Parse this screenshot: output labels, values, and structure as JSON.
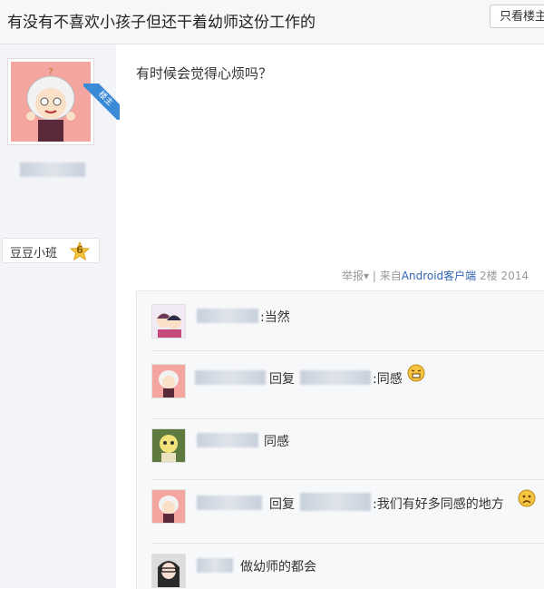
{
  "thread": {
    "title": "有没有不喜欢小孩子但还干着幼师这份工作的",
    "only_op_label": "只看楼主"
  },
  "author": {
    "op_badge": "楼主",
    "badge_label": "豆豆小班",
    "level": "6"
  },
  "post": {
    "text": "有时候会觉得心烦吗？",
    "report_label": "举报",
    "divider": "|",
    "source_prefix": "来自",
    "source_client": "Android客户端",
    "floor": "2楼",
    "time_partial": "2014"
  },
  "replies": [
    {
      "content": ":当然"
    },
    {
      "reply_word": "回复",
      "content": ":同感",
      "emoji": "grimace-emoji"
    },
    {
      "content": "同感"
    },
    {
      "reply_word": "回复",
      "content": ":我们有好多同感的地方",
      "emoji": "sad-emoji"
    },
    {
      "content": "做幼师的都会"
    }
  ]
}
